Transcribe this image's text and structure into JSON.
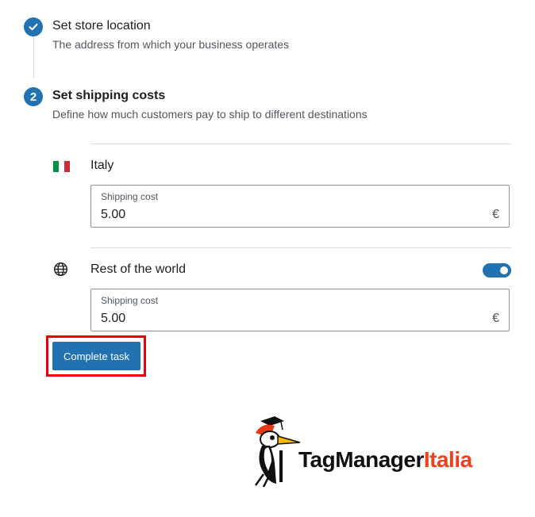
{
  "steps": [
    {
      "title": "Set store location",
      "description": "The address from which your business operates",
      "state": "completed"
    },
    {
      "number": "2",
      "title": "Set shipping costs",
      "description": "Define how much customers pay to ship to different destinations",
      "state": "active"
    }
  ],
  "shipping": {
    "italy": {
      "label": "Italy",
      "field_label": "Shipping cost",
      "value": "5.00",
      "currency": "€"
    },
    "rest_of_world": {
      "label": "Rest of the world",
      "enabled": true,
      "field_label": "Shipping cost",
      "value": "5.00",
      "currency": "€"
    }
  },
  "complete_button": "Complete task",
  "logo": {
    "part1": "TagManager",
    "part2": "Italia"
  },
  "colors": {
    "accent": "#2271b1",
    "highlight": "#e8000b",
    "logo_red": "#f0411f"
  }
}
